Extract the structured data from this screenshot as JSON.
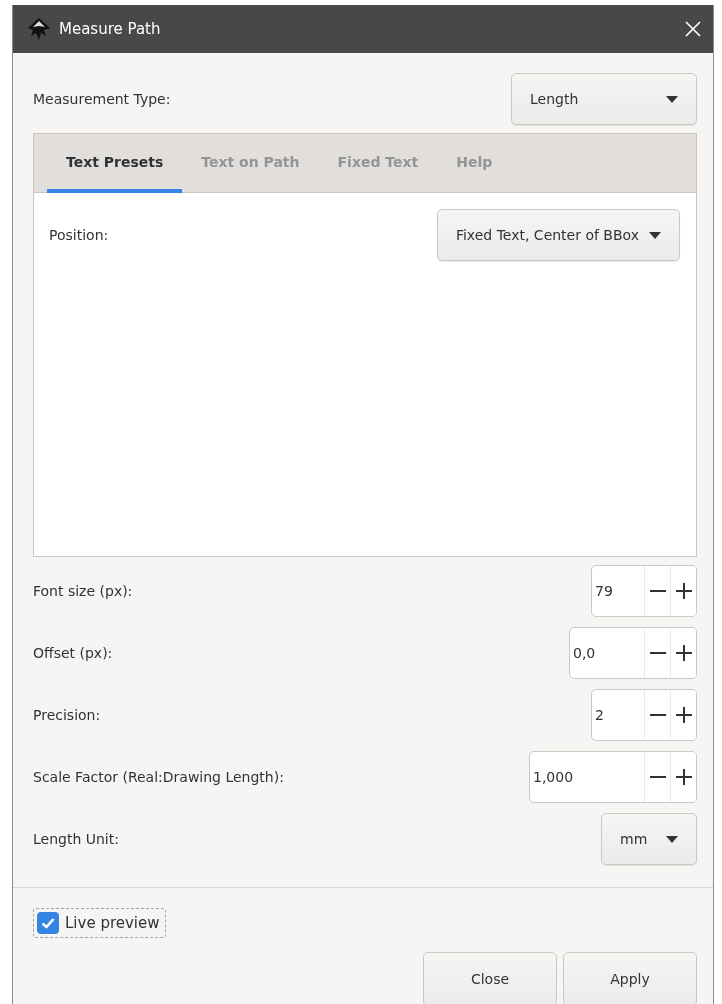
{
  "window": {
    "title": "Measure Path"
  },
  "measurement_type": {
    "label": "Measurement Type:",
    "value": "Length"
  },
  "tabs": [
    {
      "label": "Text Presets",
      "selected": true
    },
    {
      "label": "Text on Path",
      "selected": false
    },
    {
      "label": "Fixed Text",
      "selected": false
    },
    {
      "label": "Help",
      "selected": false
    }
  ],
  "position": {
    "label": "Position:",
    "value": "Fixed Text, Center of BBox"
  },
  "fields": [
    {
      "kind": "spin",
      "label": "Font size (px):",
      "value": "79"
    },
    {
      "kind": "spin",
      "label": "Offset (px):",
      "value": "0,0"
    },
    {
      "kind": "spin",
      "label": "Precision:",
      "value": "2"
    },
    {
      "kind": "spin",
      "label": "Scale Factor (Real:Drawing Length):",
      "value": "1,000"
    },
    {
      "kind": "dropdown",
      "label": "Length Unit:",
      "value": "mm"
    }
  ],
  "live_preview": {
    "label": "Live preview",
    "checked": true
  },
  "buttons": [
    "Close",
    "Apply"
  ]
}
